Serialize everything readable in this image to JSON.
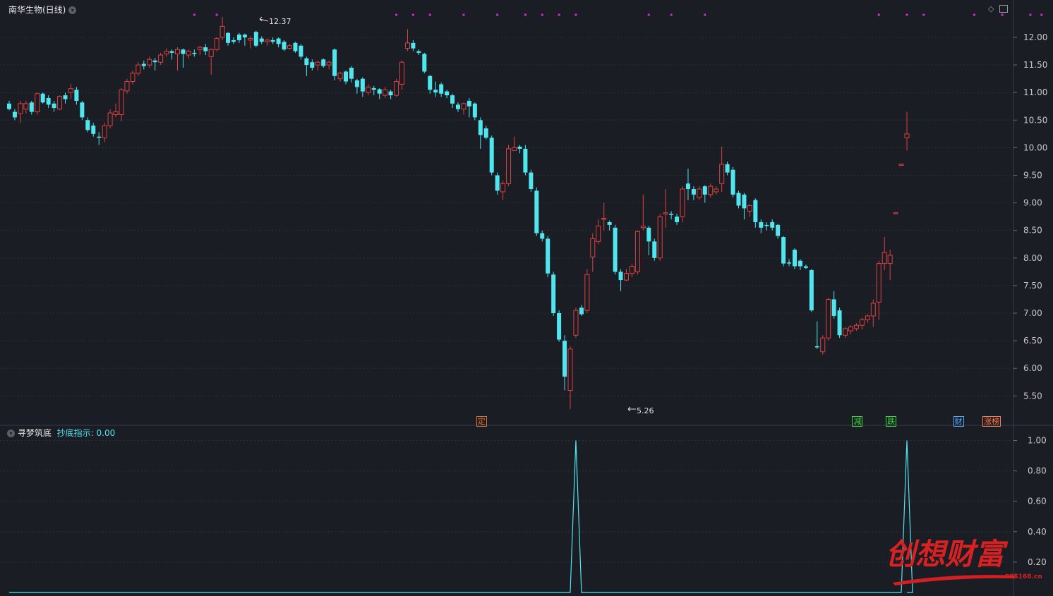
{
  "header": {
    "title": "南华生物(日线)",
    "indicator_name": "寻梦筑底",
    "indicator_label": "抄底指示:",
    "indicator_value": "0.00"
  },
  "colors": {
    "background": "#1b1d24",
    "up": "#e0403f",
    "down": "#4fe6f0",
    "grid": "#2d3038",
    "axis_text": "#c8c8c8",
    "marker": "#e020e0",
    "indicator_line": "#4fe6f0"
  },
  "annotations": {
    "high_label": "12.37",
    "low_label": "5.26"
  },
  "signal_tags": [
    {
      "text": "定",
      "index": 84,
      "color": "#e06a2a"
    },
    {
      "text": "减",
      "index": 151,
      "color": "#35d635"
    },
    {
      "text": "跌",
      "index": 157,
      "color": "#35d635"
    },
    {
      "text": "财",
      "index": 169,
      "color": "#4aa8ff"
    },
    {
      "text": "涨榜",
      "index": 175,
      "color": "#ff7a4a"
    }
  ],
  "watermark": {
    "main": "创想财富",
    "sub": "995168.cn"
  },
  "chart_data": [
    {
      "type": "candlestick",
      "title": "南华生物(日线)",
      "ylim": [
        5.2,
        12.3
      ],
      "yticks": [
        "12.00",
        "11.50",
        "11.00",
        "10.50",
        "10.00",
        "9.50",
        "9.00",
        "8.50",
        "8.00",
        "7.50",
        "7.00",
        "6.50",
        "6.00",
        "5.50"
      ],
      "candles": [
        [
          10.8,
          10.7,
          10.85,
          10.68
        ],
        [
          10.65,
          10.55,
          10.7,
          10.5
        ],
        [
          10.62,
          10.8,
          10.85,
          10.45
        ],
        [
          10.7,
          10.8,
          10.85,
          10.62
        ],
        [
          10.82,
          10.65,
          10.85,
          10.6
        ],
        [
          10.65,
          10.98,
          11.0,
          10.6
        ],
        [
          10.98,
          10.82,
          11.0,
          10.8
        ],
        [
          10.9,
          10.78,
          10.95,
          10.72
        ],
        [
          10.8,
          10.72,
          10.85,
          10.65
        ],
        [
          10.7,
          10.93,
          10.95,
          10.68
        ],
        [
          10.95,
          10.88,
          11.0,
          10.8
        ],
        [
          11.0,
          11.07,
          11.15,
          10.88
        ],
        [
          11.05,
          10.85,
          11.1,
          10.78
        ],
        [
          10.82,
          10.55,
          10.85,
          10.5
        ],
        [
          10.5,
          10.32,
          10.55,
          10.28
        ],
        [
          10.4,
          10.25,
          10.45,
          10.2
        ],
        [
          10.2,
          10.18,
          10.28,
          10.05
        ],
        [
          10.18,
          10.4,
          10.45,
          10.1
        ],
        [
          10.4,
          10.63,
          10.7,
          10.35
        ],
        [
          10.6,
          10.65,
          10.8,
          10.55
        ],
        [
          10.6,
          11.05,
          11.08,
          10.48
        ],
        [
          11.03,
          11.2,
          11.25,
          10.98
        ],
        [
          11.2,
          11.35,
          11.4,
          11.15
        ],
        [
          11.35,
          11.5,
          11.55,
          11.3
        ],
        [
          11.52,
          11.48,
          11.58,
          11.42
        ],
        [
          11.5,
          11.6,
          11.65,
          11.45
        ],
        [
          11.58,
          11.55,
          11.63,
          11.4
        ],
        [
          11.55,
          11.68,
          11.72,
          11.5
        ],
        [
          11.7,
          11.75,
          11.8,
          11.65
        ],
        [
          11.75,
          11.72,
          11.78,
          11.6
        ],
        [
          11.7,
          11.78,
          11.82,
          11.4
        ],
        [
          11.78,
          11.7,
          11.8,
          11.45
        ],
        [
          11.68,
          11.75,
          11.78,
          11.62
        ],
        [
          11.72,
          11.7,
          11.78,
          11.65
        ],
        [
          11.78,
          11.82,
          11.85,
          11.68
        ],
        [
          11.82,
          11.75,
          11.88,
          11.68
        ],
        [
          11.65,
          11.78,
          11.8,
          11.32
        ],
        [
          11.78,
          11.98,
          12.0,
          11.75
        ],
        [
          12.0,
          12.2,
          12.37,
          11.95
        ],
        [
          12.08,
          11.9,
          12.1,
          11.85
        ],
        [
          11.95,
          11.92,
          12.0,
          11.88
        ],
        [
          12.05,
          11.95,
          12.08,
          11.9
        ],
        [
          12.05,
          12.0,
          12.07,
          11.85
        ],
        [
          11.95,
          11.98,
          12.02,
          11.8
        ],
        [
          12.1,
          11.85,
          12.12,
          11.82
        ],
        [
          11.98,
          11.92,
          12.02,
          11.88
        ],
        [
          11.92,
          11.95,
          11.98,
          11.85
        ],
        [
          11.95,
          11.92,
          12.0,
          11.88
        ],
        [
          11.98,
          11.88,
          12.0,
          11.82
        ],
        [
          11.92,
          11.78,
          11.95,
          11.75
        ],
        [
          11.8,
          11.85,
          11.88,
          11.78
        ],
        [
          11.9,
          11.75,
          11.92,
          11.72
        ],
        [
          11.85,
          11.65,
          11.88,
          11.6
        ],
        [
          11.62,
          11.5,
          11.65,
          11.3
        ],
        [
          11.55,
          11.45,
          11.6,
          11.4
        ],
        [
          11.5,
          11.55,
          11.58,
          11.4
        ],
        [
          11.6,
          11.48,
          11.62,
          11.45
        ],
        [
          11.5,
          11.55,
          11.58,
          11.42
        ],
        [
          11.78,
          11.3,
          11.8,
          11.22
        ],
        [
          11.25,
          11.35,
          11.38,
          11.2
        ],
        [
          11.38,
          11.2,
          11.4,
          11.15
        ],
        [
          11.45,
          11.25,
          11.48,
          11.18
        ],
        [
          11.22,
          11.1,
          11.25,
          10.98
        ],
        [
          11.25,
          11.02,
          11.28,
          10.92
        ],
        [
          11.0,
          11.1,
          11.15,
          10.95
        ],
        [
          11.08,
          11.05,
          11.12,
          10.95
        ],
        [
          11.06,
          10.98,
          11.08,
          10.88
        ],
        [
          10.95,
          11.05,
          11.1,
          10.9
        ],
        [
          11.02,
          10.95,
          11.05,
          10.88
        ],
        [
          10.95,
          11.2,
          11.25,
          10.92
        ],
        [
          11.15,
          11.55,
          11.58,
          11.05
        ],
        [
          11.8,
          11.9,
          12.15,
          11.75
        ],
        [
          11.9,
          11.8,
          11.95,
          11.75
        ],
        [
          11.75,
          11.72,
          11.78,
          11.68
        ],
        [
          11.7,
          11.38,
          11.72,
          11.35
        ],
        [
          11.3,
          11.05,
          11.32,
          10.98
        ],
        [
          11.05,
          11.0,
          11.2,
          10.92
        ],
        [
          11.15,
          10.98,
          11.18,
          10.92
        ],
        [
          11.02,
          10.95,
          11.05,
          10.9
        ],
        [
          10.95,
          10.8,
          10.98,
          10.72
        ],
        [
          10.78,
          10.7,
          10.82,
          10.65
        ],
        [
          10.7,
          10.8,
          10.82,
          10.6
        ],
        [
          10.85,
          10.75,
          10.9,
          10.55
        ],
        [
          10.8,
          10.55,
          10.82,
          10.5
        ],
        [
          10.5,
          10.23,
          10.55,
          9.98
        ],
        [
          10.35,
          10.18,
          10.4,
          10.15
        ],
        [
          10.18,
          9.55,
          10.22,
          9.5
        ],
        [
          9.5,
          9.22,
          9.55,
          9.15
        ],
        [
          9.2,
          9.35,
          9.4,
          9.05
        ],
        [
          9.35,
          9.98,
          10.05,
          9.3
        ],
        [
          9.95,
          10.0,
          10.2,
          9.95
        ],
        [
          10.02,
          9.98,
          10.05,
          9.9
        ],
        [
          9.98,
          9.55,
          10.05,
          9.5
        ],
        [
          9.55,
          9.25,
          9.6,
          9.2
        ],
        [
          9.22,
          8.45,
          9.28,
          8.4
        ],
        [
          8.45,
          8.35,
          8.5,
          8.3
        ],
        [
          8.35,
          7.72,
          8.4,
          7.65
        ],
        [
          7.7,
          7.0,
          7.75,
          6.95
        ],
        [
          7.0,
          6.52,
          7.05,
          6.48
        ],
        [
          6.5,
          5.85,
          6.6,
          5.6
        ],
        [
          5.6,
          6.35,
          6.4,
          5.26
        ],
        [
          6.6,
          7.05,
          7.1,
          6.55
        ],
        [
          7.1,
          6.98,
          7.15,
          6.95
        ],
        [
          7.05,
          7.7,
          7.8,
          7.0
        ],
        [
          8.02,
          8.35,
          8.45,
          7.75
        ],
        [
          8.3,
          8.58,
          8.7,
          8.25
        ],
        [
          8.7,
          8.72,
          9.0,
          8.5
        ],
        [
          8.65,
          8.6,
          8.68,
          8.5
        ],
        [
          8.55,
          7.75,
          8.6,
          7.7
        ],
        [
          7.75,
          7.6,
          7.8,
          7.4
        ],
        [
          7.6,
          7.72,
          7.8,
          7.58
        ],
        [
          7.72,
          7.85,
          7.9,
          7.65
        ],
        [
          7.75,
          8.48,
          8.5,
          7.7
        ],
        [
          8.55,
          8.58,
          9.15,
          8.5
        ],
        [
          8.55,
          8.3,
          8.58,
          8.05
        ],
        [
          8.3,
          8.0,
          8.35,
          7.95
        ],
        [
          8.0,
          8.75,
          8.8,
          7.95
        ],
        [
          8.8,
          8.82,
          9.25,
          8.55
        ],
        [
          8.8,
          8.78,
          8.85,
          8.7
        ],
        [
          8.75,
          8.65,
          8.8,
          8.6
        ],
        [
          8.75,
          9.25,
          9.3,
          8.65
        ],
        [
          9.35,
          9.25,
          9.62,
          9.05
        ],
        [
          9.25,
          9.15,
          9.3,
          9.05
        ],
        [
          9.1,
          9.25,
          9.3,
          9.05
        ],
        [
          9.3,
          9.15,
          9.32,
          9.0
        ],
        [
          9.15,
          9.3,
          9.35,
          9.1
        ],
        [
          9.2,
          9.25,
          9.3,
          9.15
        ],
        [
          9.35,
          9.7,
          10.02,
          9.2
        ],
        [
          9.7,
          9.55,
          9.75,
          9.5
        ],
        [
          9.6,
          9.15,
          9.65,
          9.1
        ],
        [
          9.18,
          8.95,
          9.22,
          8.9
        ],
        [
          9.15,
          8.9,
          9.18,
          8.7
        ],
        [
          8.85,
          8.95,
          8.98,
          8.75
        ],
        [
          9.05,
          8.65,
          9.08,
          8.55
        ],
        [
          8.65,
          8.55,
          8.7,
          8.45
        ],
        [
          8.6,
          8.58,
          8.65,
          8.5
        ],
        [
          8.65,
          8.55,
          8.7,
          8.5
        ],
        [
          8.6,
          8.4,
          8.62,
          8.35
        ],
        [
          8.38,
          7.9,
          8.4,
          7.85
        ],
        [
          7.92,
          7.9,
          7.98,
          7.85
        ],
        [
          8.15,
          7.85,
          8.18,
          7.8
        ],
        [
          7.95,
          7.85,
          7.98,
          7.78
        ],
        [
          7.85,
          7.82,
          7.88,
          7.8
        ],
        [
          7.78,
          7.05,
          7.8,
          7.02
        ],
        [
          6.4,
          6.38,
          6.85,
          6.35
        ],
        [
          6.3,
          6.55,
          6.6,
          6.25
        ],
        [
          6.55,
          7.25,
          7.28,
          6.5
        ],
        [
          7.25,
          6.95,
          7.4,
          6.9
        ],
        [
          7.05,
          6.6,
          7.1,
          6.55
        ],
        [
          6.6,
          6.72,
          6.75,
          6.55
        ],
        [
          6.68,
          6.75,
          6.78,
          6.62
        ],
        [
          6.72,
          6.78,
          6.82,
          6.68
        ],
        [
          6.78,
          6.88,
          6.92,
          6.7
        ],
        [
          6.88,
          6.95,
          6.98,
          6.82
        ],
        [
          6.95,
          7.18,
          7.25,
          6.75
        ],
        [
          7.2,
          7.9,
          7.95,
          6.88
        ],
        [
          7.9,
          8.1,
          8.38,
          7.78
        ],
        [
          7.9,
          8.05,
          8.15,
          7.6
        ],
        [
          8.82,
          8.82,
          8.83,
          8.81
        ],
        [
          9.7,
          9.7,
          9.71,
          9.69
        ],
        [
          10.18,
          10.25,
          10.65,
          9.95
        ]
      ],
      "top_marker_indices": [
        33,
        37,
        69,
        72,
        75,
        81,
        87,
        92,
        95,
        98,
        101,
        114,
        118,
        124,
        155,
        160,
        163,
        172,
        177,
        182,
        184
      ]
    },
    {
      "type": "line",
      "title": "寻梦筑底",
      "series": [
        {
          "name": "抄底指示",
          "spikes": [
            {
              "index": 101,
              "value": 1.0
            },
            {
              "index": 160,
              "value": 1.0
            }
          ],
          "baseline": 0.0
        }
      ],
      "ylim": [
        0,
        1.0
      ],
      "yticks": [
        "1.00",
        "0.80",
        "0.60",
        "0.40",
        "0.20"
      ]
    }
  ]
}
